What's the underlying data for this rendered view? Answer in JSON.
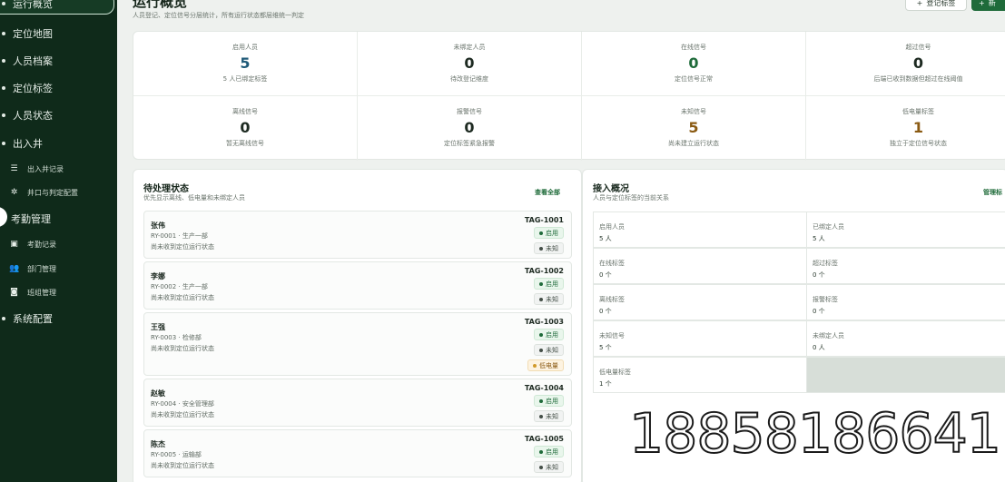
{
  "sidebar": {
    "items": [
      {
        "label": "运行概览"
      },
      {
        "label": "定位地图"
      },
      {
        "label": "人员档案"
      },
      {
        "label": "定位标签"
      },
      {
        "label": "人员状态"
      },
      {
        "label": "出入井"
      }
    ],
    "sub_access": [
      {
        "label": "出入井记录"
      },
      {
        "label": "井口与判定配置"
      }
    ],
    "attendance": {
      "label": "考勤管理"
    },
    "sub_attendance": [
      {
        "label": "考勤记录"
      },
      {
        "label": "部门管理"
      },
      {
        "label": "班组管理"
      }
    ],
    "settings": {
      "label": "系统配置"
    }
  },
  "header": {
    "title": "运行概览",
    "subtitle": "人员登记、定位信号分层统计，所有运行状态都层维统一判定",
    "btn_register": "登记标签",
    "btn_add": "新"
  },
  "stats": [
    {
      "label": "启用人员",
      "value": "5",
      "desc": "5 人已绑定标签",
      "color": "#1f5a78"
    },
    {
      "label": "未绑定人员",
      "value": "0",
      "desc": "待改登记维度",
      "color": "#1d2a21"
    },
    {
      "label": "在线信号",
      "value": "0",
      "desc": "定位信号正常",
      "color": "#1f6b3a"
    },
    {
      "label": "超过信号",
      "value": "0",
      "desc": "后端已收到数据但超过在线阈值",
      "color": "#1d2a21"
    },
    {
      "label": "离线信号",
      "value": "0",
      "desc": "暂无离线信号",
      "color": "#1d2a21"
    },
    {
      "label": "报警信号",
      "value": "0",
      "desc": "定位标签紧急报警",
      "color": "#1d2a21"
    },
    {
      "label": "未知信号",
      "value": "5",
      "desc": "尚未建立运行状态",
      "color": "#8a5a12"
    },
    {
      "label": "低电量标签",
      "value": "1",
      "desc": "独立于定位信号状态",
      "color": "#8a5a12"
    }
  ],
  "pending": {
    "title": "待处理状态",
    "subtitle": "优先显示离线、低电量和未绑定人员",
    "view_all": "查看全部",
    "rows": [
      {
        "name": "张伟",
        "meta": "RY-0001 · 生产一部",
        "note": "尚未收到定位运行状态",
        "tag": "TAG-1001",
        "badges": [
          {
            "label": "启用",
            "kind": "on"
          },
          {
            "label": "未知",
            "kind": "un"
          }
        ]
      },
      {
        "name": "李娜",
        "meta": "RY-0002 · 生产一部",
        "note": "尚未收到定位运行状态",
        "tag": "TAG-1002",
        "badges": [
          {
            "label": "启用",
            "kind": "on"
          },
          {
            "label": "未知",
            "kind": "un"
          }
        ]
      },
      {
        "name": "王强",
        "meta": "RY-0003 · 检修部",
        "note": "尚未收到定位运行状态",
        "tag": "TAG-1003",
        "badges": [
          {
            "label": "启用",
            "kind": "on"
          },
          {
            "label": "未知",
            "kind": "un"
          },
          {
            "label": "低电量",
            "kind": "low"
          }
        ]
      },
      {
        "name": "赵敏",
        "meta": "RY-0004 · 安全管理部",
        "note": "尚未收到定位运行状态",
        "tag": "TAG-1004",
        "badges": [
          {
            "label": "启用",
            "kind": "on"
          },
          {
            "label": "未知",
            "kind": "un"
          }
        ]
      },
      {
        "name": "陈杰",
        "meta": "RY-0005 · 运输部",
        "note": "尚未收到定位运行状态",
        "tag": "TAG-1005",
        "badges": [
          {
            "label": "启用",
            "kind": "on"
          },
          {
            "label": "未知",
            "kind": "un"
          }
        ]
      }
    ]
  },
  "access": {
    "title": "接入概况",
    "subtitle": "人员与定位标签的当前关系",
    "manage": "管理标",
    "cells": [
      {
        "label": "启用人员",
        "value": "5 人"
      },
      {
        "label": "已绑定人员",
        "value": "5 人"
      },
      {
        "label": "在线标签",
        "value": "0 个"
      },
      {
        "label": "超过标签",
        "value": "0 个"
      },
      {
        "label": "离线标签",
        "value": "0 个"
      },
      {
        "label": "报警标签",
        "value": "0 个"
      },
      {
        "label": "未知信号",
        "value": "5 个"
      },
      {
        "label": "未绑定人员",
        "value": "0 人"
      },
      {
        "label": "低电量标签",
        "value": "1 个"
      }
    ]
  },
  "watermark": "18858186641"
}
